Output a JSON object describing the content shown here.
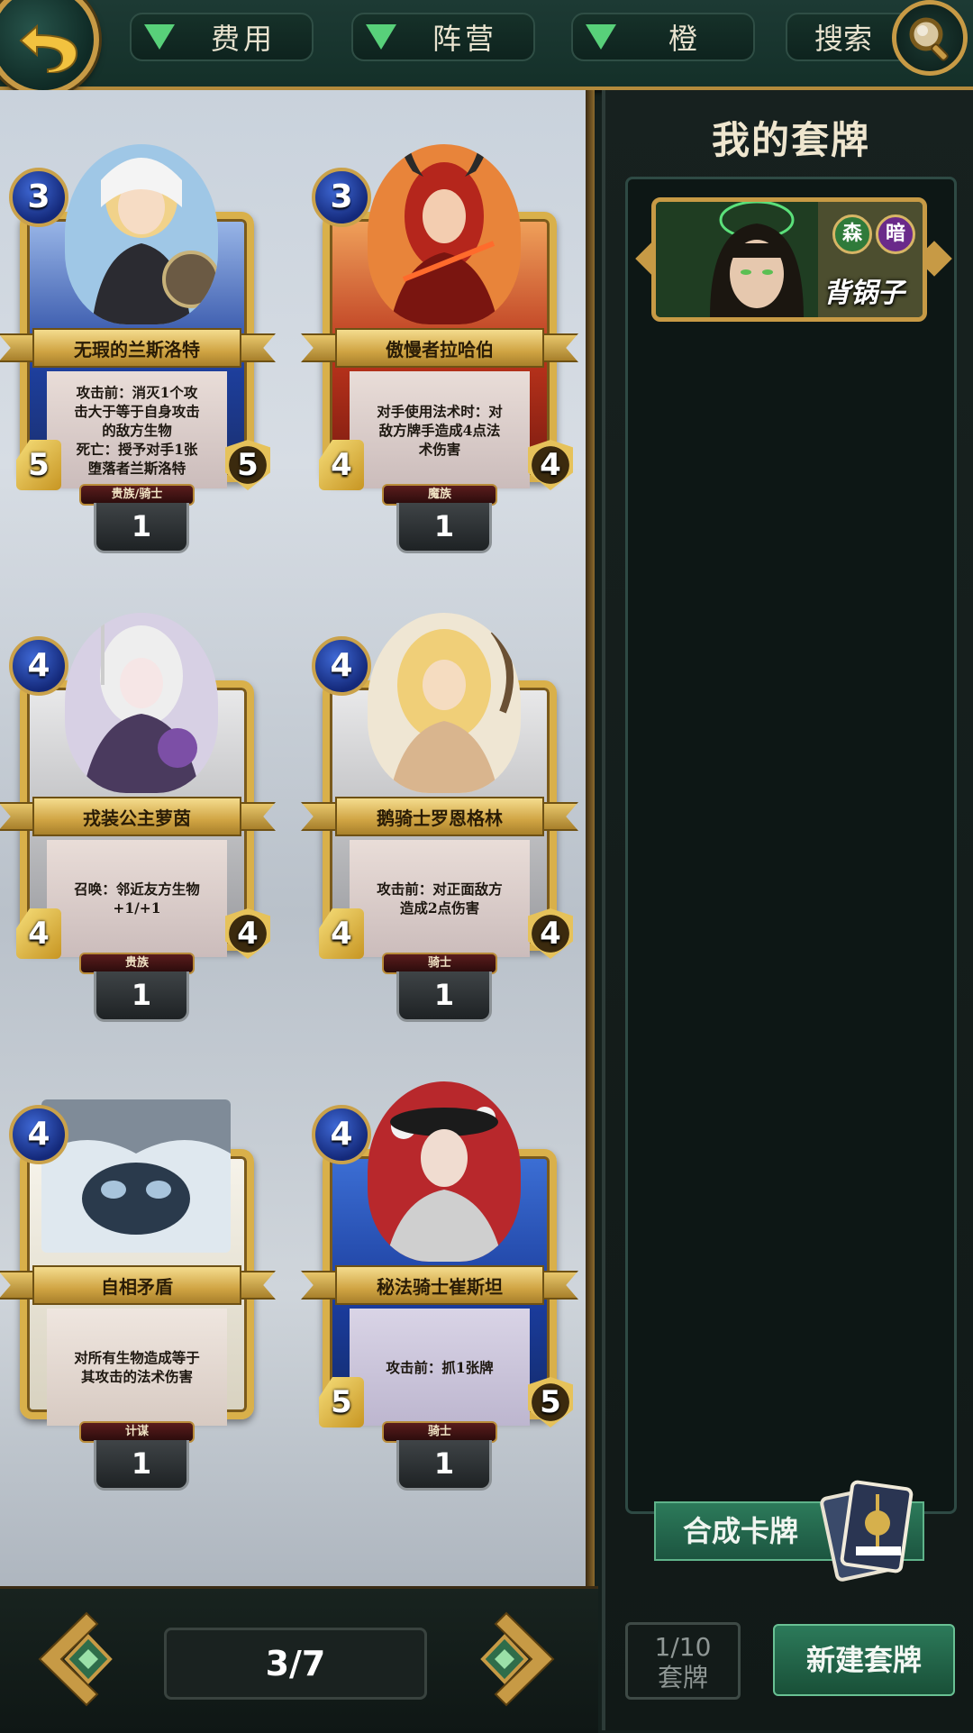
{
  "topbar": {
    "filters": [
      {
        "label": "费用"
      },
      {
        "label": "阵营"
      },
      {
        "label": "橙"
      }
    ],
    "search_label": "搜索"
  },
  "cards": [
    {
      "name": "无瑕的兰斯洛特",
      "cost": "3",
      "attack": "5",
      "health": "5",
      "text": "攻击前：消灭1个攻\n击大于等于自身攻击\n的敌方生物\n死亡：授予对手1张\n堕落者兰斯洛特",
      "tribe": "贵族/骑士",
      "count": "1"
    },
    {
      "name": "傲慢者拉哈伯",
      "cost": "3",
      "attack": "4",
      "health": "4",
      "text": "对手使用法术时：对\n敌方牌手造成4点法\n术伤害",
      "tribe": "魔族",
      "count": "1"
    },
    {
      "name": "戎装公主萝茵",
      "cost": "4",
      "attack": "4",
      "health": "4",
      "text": "召唤：邻近友方生物\n+1/+1",
      "tribe": "贵族",
      "count": "1"
    },
    {
      "name": "鹅骑士罗恩格林",
      "cost": "4",
      "attack": "4",
      "health": "4",
      "text": "攻击前：对正面敌方\n造成2点伤害",
      "tribe": "骑士",
      "count": "1"
    },
    {
      "name": "自相矛盾",
      "cost": "4",
      "attack": "",
      "health": "",
      "text": "对所有生物造成等于\n其攻击的法术伤害",
      "tribe": "计谋",
      "count": "1"
    },
    {
      "name": "秘法骑士崔斯坦",
      "cost": "4",
      "attack": "5",
      "health": "5",
      "text": "攻击前：抓1张牌",
      "tribe": "骑士",
      "count": "1"
    }
  ],
  "pager": {
    "page": "3/7"
  },
  "deck_panel": {
    "title": "我的套牌",
    "decks": [
      {
        "name": "背锅子",
        "factions": [
          "森",
          "暗"
        ]
      }
    ],
    "craft_label": "合成卡牌",
    "deck_count_value": "1/10",
    "deck_count_label": "套牌",
    "new_deck_label": "新建套牌"
  },
  "colors": {
    "gold": "#c79a45",
    "accent_green": "#58d07a",
    "button_green": "#2c7a5a",
    "cost_blue": "#3f69d6",
    "faction_forest": "#2f7a3a",
    "faction_dark": "#6a2a8a"
  },
  "icons": [
    "back-arrow-icon",
    "triangle-down-icon",
    "magnifier-icon",
    "chevron-left-icon",
    "chevron-right-icon"
  ]
}
